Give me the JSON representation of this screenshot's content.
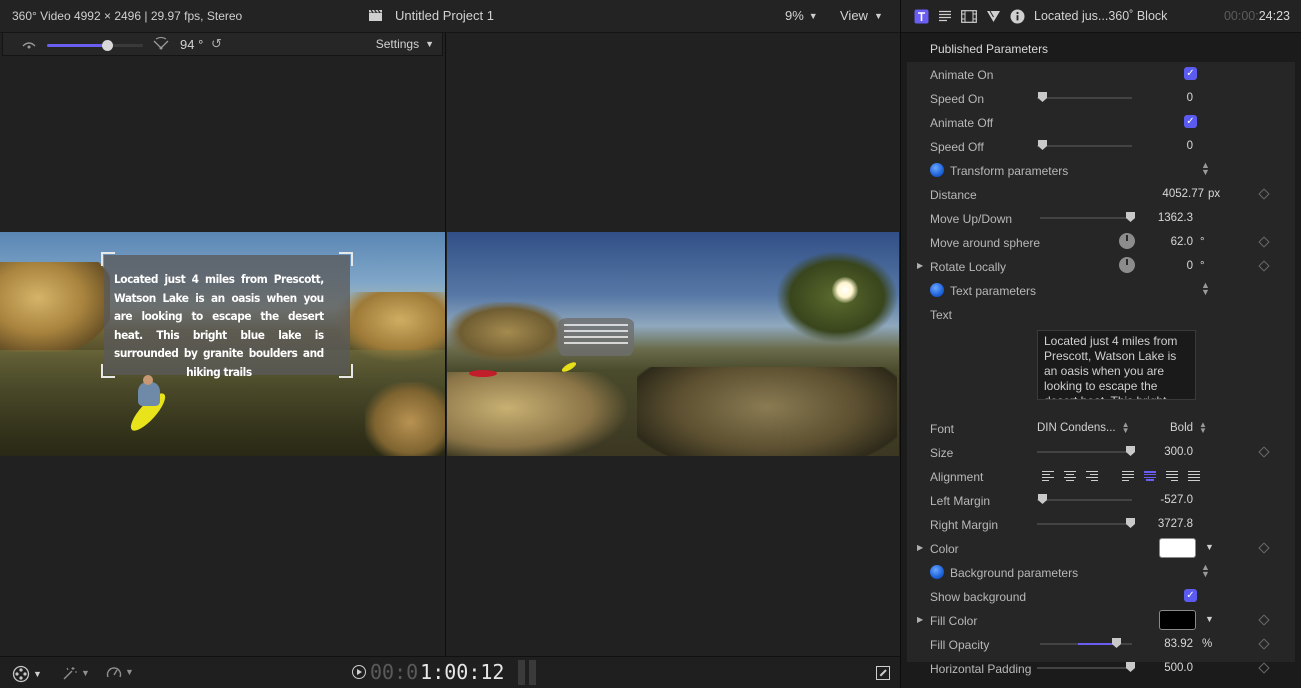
{
  "viewer": {
    "format_info": "360° Video 4992 × 2496 | 29.97 fps, Stereo",
    "project_title": "Untitled Project 1",
    "zoom": "9%",
    "view_label": "View",
    "angle_value": "94 °",
    "settings_label": "Settings",
    "fov_slider_fraction": 0.62,
    "overlay_text": "Located just 4 miles from Prescott, Watson Lake is an oasis when you are looking to escape the desert heat. This bright blue lake is surrounded by granite boulders and hiking trails",
    "timecode_dim": "00:0",
    "timecode_bright": "1:00:12"
  },
  "inspector": {
    "title": "Located jus...360˚ Block",
    "time_dim": "00:00:",
    "time_bright": "24:23",
    "section_title": "Published Parameters",
    "animate_on_label": "Animate On",
    "speed_on_label": "Speed On",
    "speed_on_value": "0",
    "animate_off_label": "Animate Off",
    "speed_off_label": "Speed Off",
    "speed_off_value": "0",
    "transform_label": "Transform parameters",
    "distance_label": "Distance",
    "distance_value": "4052.77",
    "distance_unit": "px",
    "move_updown_label": "Move Up/Down",
    "move_updown_value": "1362.3",
    "move_sphere_label": "Move around sphere",
    "move_sphere_value": "62.0",
    "deg_unit": "°",
    "rotate_locally_label": "Rotate Locally",
    "rotate_locally_value": "0",
    "text_params_label": "Text parameters",
    "text_label": "Text",
    "text_value": "Located just 4 miles from Prescott, Watson Lake is an oasis when you are looking to escape the desert heat. This bright blue lake is surrounded by granite boulders and hiking trails",
    "font_label": "Font",
    "font_family": "DIN Condens...",
    "font_weight": "Bold",
    "size_label": "Size",
    "size_value": "300.0",
    "alignment_label": "Alignment",
    "left_margin_label": "Left Margin",
    "left_margin_value": "-527.0",
    "right_margin_label": "Right Margin",
    "right_margin_value": "3727.8",
    "color_label": "Color",
    "color_value": "#ffffff",
    "background_params_label": "Background parameters",
    "show_background_label": "Show background",
    "fill_color_label": "Fill Color",
    "fill_color_value": "#000000",
    "fill_opacity_label": "Fill Opacity",
    "fill_opacity_value": "83.92",
    "fill_opacity_unit": "%",
    "horizontal_padding_label": "Horizontal Padding",
    "horizontal_padding_value": "500.0"
  },
  "colors": {
    "accent": "#6a5df2",
    "checkbox": "#5b5bf0"
  }
}
